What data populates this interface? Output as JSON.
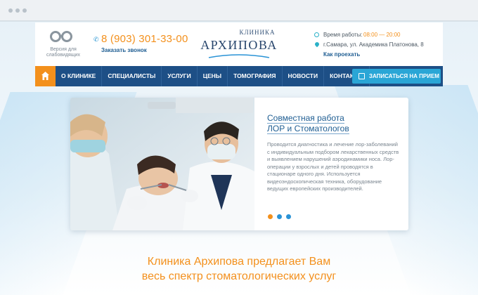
{
  "header": {
    "low_vision_label": "Версия для слабовидящих",
    "phone": "8 (903) 301-33-00",
    "callback_link": "Заказать звонок",
    "logo_top": "КЛИНИКА",
    "logo_main": "АРХИПОВА",
    "hours_label": "Время работы:",
    "hours_value": "08:00 — 20:00",
    "address": "г.Самара, ул. Академика Платонова, 8",
    "route_link": "Как проехать"
  },
  "nav": {
    "items": [
      "О КЛИНИКЕ",
      "СПЕЦИАЛИСТЫ",
      "УСЛУГИ",
      "ЦЕНЫ",
      "ТОМОГРАФИЯ",
      "НОВОСТИ",
      "КОНТАКТЫ"
    ],
    "cta_label": "ЗАПИСАТЬСЯ НА ПРИЕМ"
  },
  "slide": {
    "title_line1": "Совместная работа",
    "title_line2": "ЛОР и Стоматологов",
    "text": "Проводится диагностика и лечение лор-заболеваний с индивидуальным подбором лекарственных средств и выявлением нарушений аэродинамики носа. Лор-операции у взрослых и детей проводятся в стационаре одного дня. Используется видеоэндоскопическая техника, оборудование ведущих европейских производителей."
  },
  "main": {
    "heading_line1": "Клиника Архипова предлагает Вам",
    "heading_line2": "весь спектр стоматологических услуг"
  },
  "colors": {
    "accent_orange": "#f3901c",
    "nav_blue": "#1d4f86",
    "cta_blue": "#2aa6d6",
    "link_blue": "#1e5d92"
  },
  "icons": [
    "glasses-icon",
    "phone-icon",
    "clock-icon",
    "pin-icon",
    "home-icon",
    "edit-icon"
  ]
}
